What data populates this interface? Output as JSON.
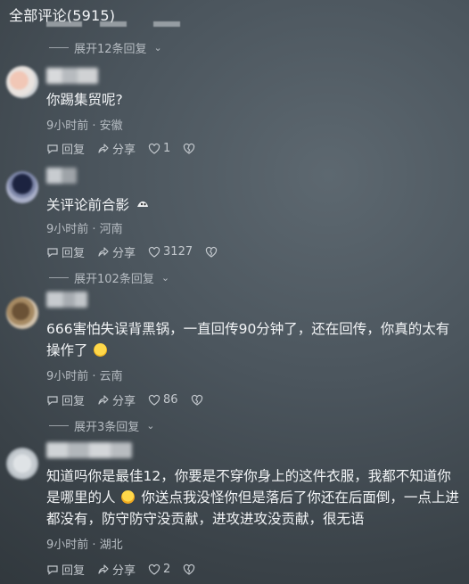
{
  "header": {
    "title": "全部评论(5915)"
  },
  "expand_top": {
    "label": "展开12条回复"
  },
  "comments": [
    {
      "text": "你踢集贸呢?",
      "meta": "9小时前 · 安徽",
      "reply": "回复",
      "share": "分享",
      "likes": "1",
      "dislike_icon": "broken-heart-icon"
    },
    {
      "text": "关评论前合影",
      "meta": "9小时前 · 河南",
      "reply": "回复",
      "share": "分享",
      "likes": "3127",
      "dislike_icon": "broken-heart-icon",
      "expand": "展开102条回复"
    },
    {
      "text": "666害怕失误背黑锅，一直回传90分钟了，还在回传，你真的太有操作了",
      "meta": "9小时前 · 云南",
      "reply": "回复",
      "share": "分享",
      "likes": "86",
      "dislike_icon": "broken-heart-icon",
      "expand": "展开3条回复"
    },
    {
      "text_part1": "知道吗你是最佳12，你要是不穿你身上的这件衣服，我都不知道你是哪里的人",
      "text_part2": "你送点我没怪你但是落后了你还在后面倒，一点上进都没有，防守防守没贡献，进攻进攻没贡献，很无语",
      "meta": "9小时前 · 湖北",
      "reply": "回复",
      "share": "分享",
      "likes": "2",
      "dislike_icon": "broken-heart-icon"
    }
  ],
  "colors": {
    "background": "#4b555d",
    "text": "#f2f4f6",
    "muted": "#b7bdc3"
  }
}
